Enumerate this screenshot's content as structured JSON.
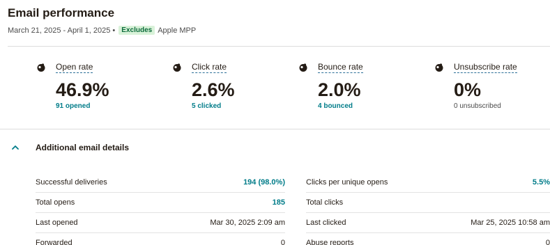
{
  "header": {
    "title": "Email performance",
    "date_range": "March 21, 2025 - April 1, 2025 •",
    "badge": "Excludes",
    "badge_target": "Apple MPP"
  },
  "metrics": [
    {
      "label": "Open rate",
      "value": "46.9%",
      "sub": "91 opened",
      "icon": "mailchimp-icon"
    },
    {
      "label": "Click rate",
      "value": "2.6%",
      "sub": "5 clicked",
      "icon": "mailchimp-icon"
    },
    {
      "label": "Bounce rate",
      "value": "2.0%",
      "sub": "4 bounced",
      "icon": "mailchimp-icon"
    },
    {
      "label": "Unsubscribe rate",
      "value": "0%",
      "sub": "0 unsubscribed",
      "icon": "mailchimp-icon"
    }
  ],
  "details": {
    "title": "Additional email details",
    "toggle_icon": "chevron-up-icon",
    "left": [
      {
        "label": "Successful deliveries",
        "value": "194 (98.0%)"
      },
      {
        "label": "Total opens",
        "value": "185"
      },
      {
        "label": "Last opened",
        "value": "Mar 30, 2025 2:09 am"
      },
      {
        "label": "Forwarded",
        "value": "0"
      }
    ],
    "right": [
      {
        "label": "Clicks per unique opens",
        "value": "5.5%"
      },
      {
        "label": "Total clicks",
        "value": ""
      },
      {
        "label": "Last clicked",
        "value": "Mar 25, 2025 10:58 am"
      },
      {
        "label": "Abuse reports",
        "value": "0"
      }
    ]
  },
  "colors": {
    "accent": "#007c89",
    "badge_bg": "#d9f2d9",
    "badge_text": "#0b6b3a",
    "text": "#241c15"
  }
}
